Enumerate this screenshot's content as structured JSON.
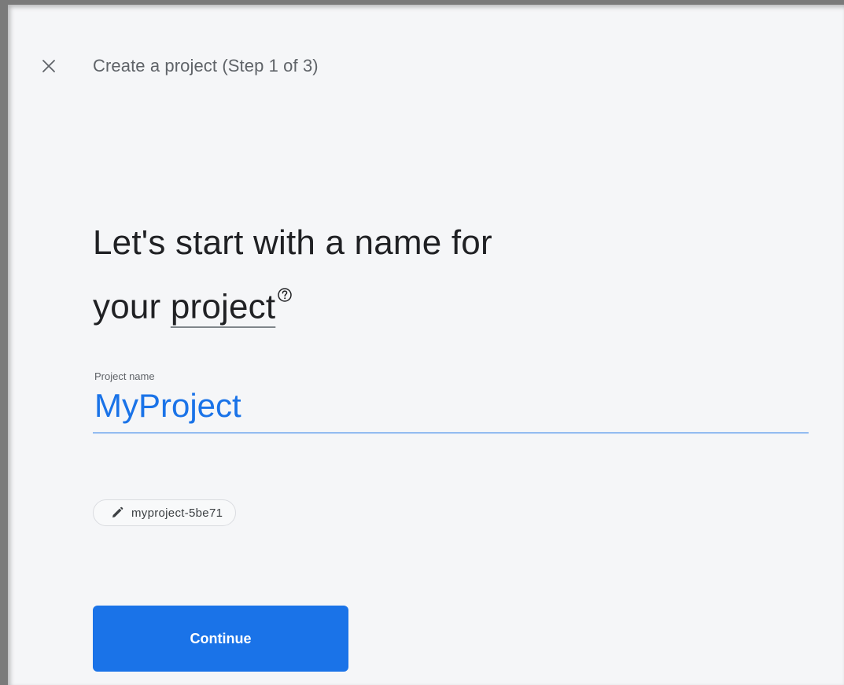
{
  "header": {
    "title": "Create a project (Step 1 of 3)",
    "close_icon": "close-icon"
  },
  "heading": {
    "line1": "Let's start with a name for",
    "line2_prefix": "your ",
    "term": "project",
    "help_icon": "help-circle-icon"
  },
  "project_name_field": {
    "label": "Project name",
    "value": "MyProject"
  },
  "project_id_chip": {
    "icon": "pencil-icon",
    "value": "myproject-5be71"
  },
  "actions": {
    "continue_label": "Continue"
  },
  "colors": {
    "accent": "#1a73e8",
    "background": "#f5f6f8",
    "text_primary": "#202124",
    "text_secondary": "#5f6368"
  }
}
